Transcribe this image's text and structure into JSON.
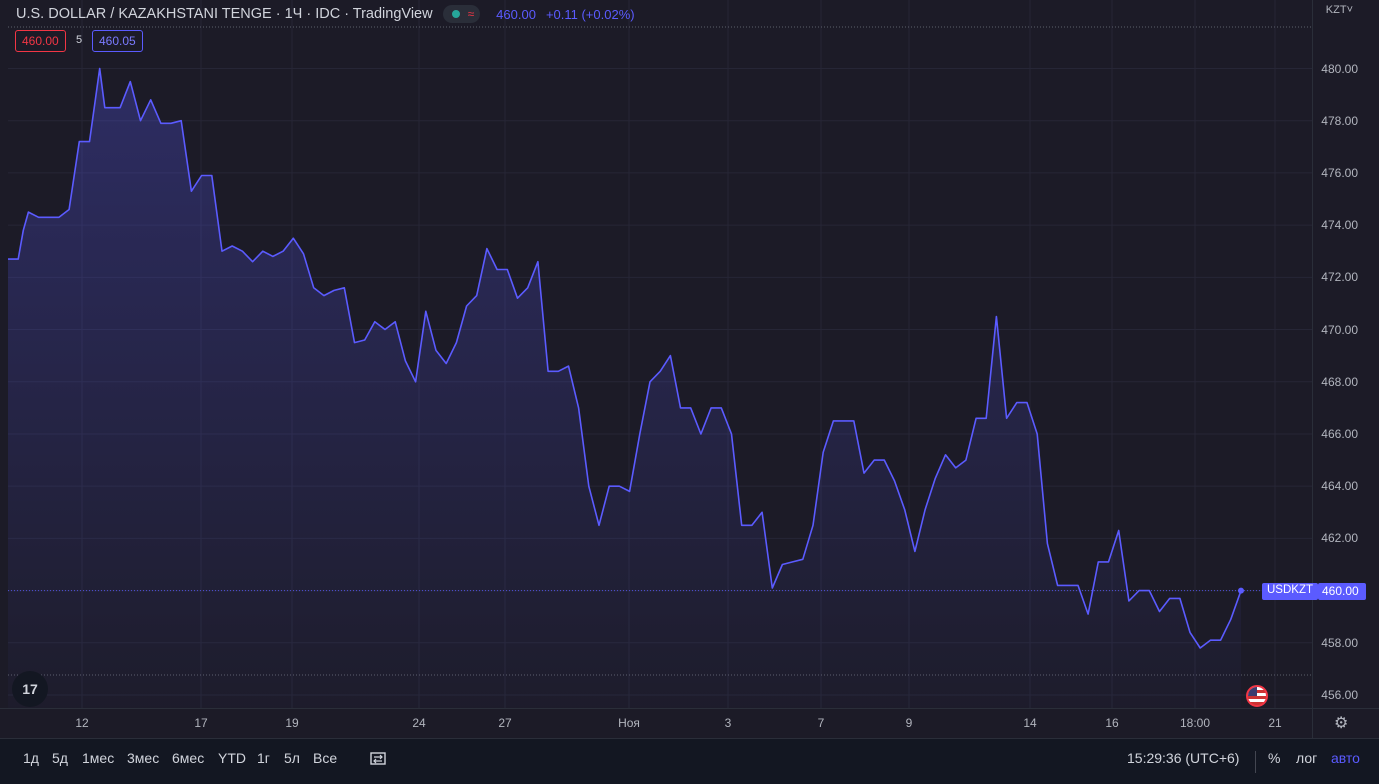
{
  "legend": {
    "title": "U.S. DOLLAR / KAZAKHSTANI TENGE · 1Ч · IDC · TradingView",
    "wave_icon": "≈",
    "last_price": "460.00",
    "change": "+0.11 (+0.02%)"
  },
  "quote": {
    "bid": "460.00",
    "spread": "5",
    "ask": "460.05"
  },
  "price_axis": {
    "currency": "KZT˅",
    "ticks": [
      "480.00",
      "478.00",
      "476.00",
      "474.00",
      "472.00",
      "470.00",
      "468.00",
      "466.00",
      "464.00",
      "462.00",
      "460.00",
      "458.00",
      "456.00"
    ],
    "symbol_tag": "USDKZT",
    "price_tag": "460.00"
  },
  "time_axis": {
    "labels": [
      "12",
      "17",
      "19",
      "24",
      "27",
      "Ноя",
      "3",
      "7",
      "9",
      "14",
      "16",
      "18:00",
      "21"
    ]
  },
  "logo": "17",
  "toolbar": {
    "ranges": [
      "1д",
      "5д",
      "1мес",
      "3мес",
      "6мес",
      "YTD",
      "1г",
      "5л",
      "Все"
    ],
    "time": "15:29:36 (UTC+6)",
    "percent": "%",
    "log": "лог",
    "auto": "авто"
  },
  "colors": {
    "line": "#5b5bff",
    "bid": "#f23645",
    "background": "#1c1b27"
  },
  "chart_data": {
    "type": "area",
    "series": [
      {
        "name": "USDKZT",
        "points": [
          [
            0,
            472.7
          ],
          [
            1,
            472.7
          ],
          [
            1.5,
            473.8
          ],
          [
            2,
            474.5
          ],
          [
            3,
            474.3
          ],
          [
            5,
            474.3
          ],
          [
            6,
            474.6
          ],
          [
            7,
            477.2
          ],
          [
            8,
            477.2
          ],
          [
            9,
            480.0
          ],
          [
            9.5,
            478.5
          ],
          [
            11,
            478.5
          ],
          [
            12,
            479.5
          ],
          [
            13,
            478.0
          ],
          [
            14,
            478.8
          ],
          [
            15,
            477.9
          ],
          [
            16,
            477.9
          ],
          [
            17,
            478.0
          ],
          [
            18,
            475.3
          ],
          [
            19,
            475.9
          ],
          [
            20,
            475.9
          ],
          [
            21,
            473.0
          ],
          [
            22,
            473.2
          ],
          [
            23,
            473.0
          ],
          [
            24,
            472.6
          ],
          [
            25,
            473.0
          ],
          [
            26,
            472.8
          ],
          [
            27,
            473.0
          ],
          [
            28,
            473.5
          ],
          [
            29,
            472.9
          ],
          [
            30,
            471.6
          ],
          [
            31,
            471.3
          ],
          [
            32,
            471.5
          ],
          [
            33,
            471.6
          ],
          [
            34,
            469.5
          ],
          [
            35,
            469.6
          ],
          [
            36,
            470.3
          ],
          [
            37,
            470.0
          ],
          [
            38,
            470.3
          ],
          [
            39,
            468.8
          ],
          [
            40,
            468.0
          ],
          [
            41,
            470.7
          ],
          [
            42,
            469.2
          ],
          [
            43,
            468.7
          ],
          [
            44,
            469.5
          ],
          [
            45,
            470.9
          ],
          [
            46,
            471.3
          ],
          [
            47,
            473.1
          ],
          [
            48,
            472.3
          ],
          [
            49,
            472.3
          ],
          [
            50,
            471.2
          ],
          [
            51,
            471.6
          ],
          [
            52,
            472.6
          ],
          [
            53,
            468.4
          ],
          [
            54,
            468.4
          ],
          [
            55,
            468.6
          ],
          [
            56,
            467.0
          ],
          [
            57,
            464.0
          ],
          [
            58,
            462.5
          ],
          [
            59,
            464.0
          ],
          [
            60,
            464.0
          ],
          [
            61,
            463.8
          ],
          [
            62,
            466.0
          ],
          [
            63,
            468.0
          ],
          [
            64,
            468.4
          ],
          [
            65,
            469.0
          ],
          [
            66,
            467.0
          ],
          [
            67,
            467.0
          ],
          [
            68,
            466.0
          ],
          [
            69,
            467.0
          ],
          [
            70,
            467.0
          ],
          [
            71,
            466.0
          ],
          [
            72,
            462.5
          ],
          [
            73,
            462.5
          ],
          [
            74,
            463.0
          ],
          [
            75,
            460.1
          ],
          [
            76,
            461.0
          ],
          [
            77,
            461.1
          ],
          [
            78,
            461.2
          ],
          [
            79,
            462.5
          ],
          [
            80,
            465.3
          ],
          [
            81,
            466.5
          ],
          [
            82,
            466.5
          ],
          [
            83,
            466.5
          ],
          [
            84,
            464.5
          ],
          [
            85,
            465.0
          ],
          [
            86,
            465.0
          ],
          [
            87,
            464.2
          ],
          [
            88,
            463.1
          ],
          [
            89,
            461.5
          ],
          [
            90,
            463.1
          ],
          [
            91,
            464.3
          ],
          [
            92,
            465.2
          ],
          [
            93,
            464.7
          ],
          [
            94,
            465.0
          ],
          [
            95,
            466.6
          ],
          [
            96,
            466.6
          ],
          [
            97,
            470.5
          ],
          [
            98,
            466.6
          ],
          [
            99,
            467.2
          ],
          [
            100,
            467.2
          ],
          [
            101,
            466.0
          ],
          [
            102,
            461.8
          ],
          [
            103,
            460.2
          ],
          [
            104,
            460.2
          ],
          [
            105,
            460.2
          ],
          [
            106,
            459.1
          ],
          [
            107,
            461.1
          ],
          [
            108,
            461.1
          ],
          [
            109,
            462.3
          ],
          [
            110,
            459.6
          ],
          [
            111,
            460.0
          ],
          [
            112,
            460.0
          ],
          [
            113,
            459.2
          ],
          [
            114,
            459.7
          ],
          [
            115,
            459.7
          ],
          [
            116,
            458.4
          ],
          [
            117,
            457.8
          ],
          [
            118,
            458.1
          ],
          [
            119,
            458.1
          ],
          [
            120,
            458.9
          ],
          [
            121,
            460.0
          ]
        ]
      }
    ],
    "ylim": [
      456.0,
      481.0
    ],
    "grid": true
  }
}
